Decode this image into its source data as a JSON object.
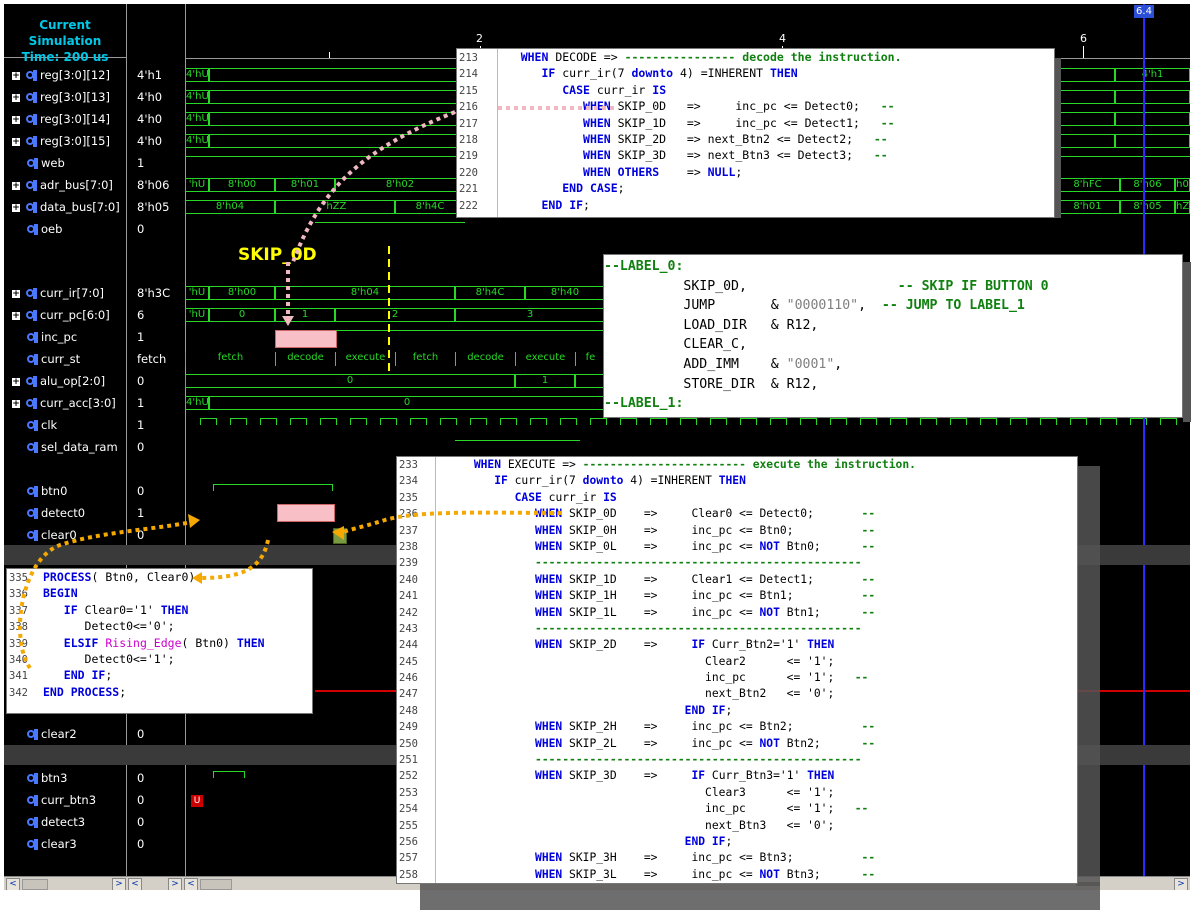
{
  "simulation": {
    "title_line1": "Current Simulation",
    "title_line2": "Time: 200 us",
    "cursor_label": "6.4",
    "ruler_labels": [
      "2",
      "4",
      "6"
    ]
  },
  "signals": [
    {
      "name": "reg[3:0][12]",
      "value": "4'h1",
      "expand": true,
      "icon": "bus-icon"
    },
    {
      "name": "reg[3:0][13]",
      "value": "4'h0",
      "expand": true,
      "icon": "bus-icon"
    },
    {
      "name": "reg[3:0][14]",
      "value": "4'h0",
      "expand": true,
      "icon": "bus-icon"
    },
    {
      "name": "reg[3:0][15]",
      "value": "4'h0",
      "expand": true,
      "icon": "bus-icon"
    },
    {
      "name": "web",
      "value": "1",
      "expand": false,
      "icon": "bit-icon"
    },
    {
      "name": "adr_bus[7:0]",
      "value": "8'h06",
      "expand": true,
      "icon": "bus-icon"
    },
    {
      "name": "data_bus[7:0]",
      "value": "8'h05",
      "expand": true,
      "icon": "bus-icon"
    },
    {
      "name": "oeb",
      "value": "0",
      "expand": false,
      "icon": "bit-icon"
    },
    {
      "name": "curr_ir[7:0]",
      "value": "8'h3C",
      "expand": true,
      "icon": "bus-icon"
    },
    {
      "name": "curr_pc[6:0]",
      "value": "6",
      "expand": true,
      "icon": "bus-icon"
    },
    {
      "name": "inc_pc",
      "value": "1",
      "expand": false,
      "icon": "bit-icon"
    },
    {
      "name": "curr_st",
      "value": "fetch",
      "expand": false,
      "icon": "bit-icon"
    },
    {
      "name": "alu_op[2:0]",
      "value": "0",
      "expand": true,
      "icon": "bus-icon"
    },
    {
      "name": "curr_acc[3:0]",
      "value": "1",
      "expand": true,
      "icon": "bus-icon"
    },
    {
      "name": "clk",
      "value": "1",
      "expand": false,
      "icon": "bit-icon"
    },
    {
      "name": "sel_data_ram",
      "value": "0",
      "expand": false,
      "icon": "bit-icon"
    },
    {
      "name": "btn0",
      "value": "0",
      "expand": false,
      "icon": "bit-icon"
    },
    {
      "name": "detect0",
      "value": "1",
      "expand": false,
      "icon": "bit-icon"
    },
    {
      "name": "clear0",
      "value": "0",
      "expand": false,
      "icon": "bit-icon"
    },
    {
      "name": "clear2",
      "value": "0",
      "expand": false,
      "icon": "bit-icon"
    },
    {
      "name": "btn3",
      "value": "0",
      "expand": false,
      "icon": "bit-icon"
    },
    {
      "name": "curr_btn3",
      "value": "0",
      "expand": false,
      "icon": "bit-icon"
    },
    {
      "name": "detect3",
      "value": "0",
      "expand": false,
      "icon": "bit-icon"
    },
    {
      "name": "clear3",
      "value": "0",
      "expand": false,
      "icon": "bit-icon"
    }
  ],
  "waves": {
    "reg12_right": "4'h1",
    "adr_bus": [
      "'hU",
      "8'h00",
      "8'h01",
      "8'h02",
      "8'hFC",
      "8'h06",
      "h0"
    ],
    "data_bus": [
      "8'h04",
      "'hZZ",
      "8'h4C",
      "8'h01",
      "8'h05",
      "hZ"
    ],
    "curr_ir": [
      "'hU",
      "8'h00",
      "8'h04",
      "8'h4C",
      "8'h40"
    ],
    "curr_pc": [
      "'hU",
      "0",
      "1",
      "2",
      "3"
    ],
    "curr_st": [
      "fetch",
      "decode",
      "execute",
      "fetch",
      "decode",
      "execute",
      "fe"
    ],
    "alu_op": [
      "0",
      "1"
    ],
    "curr_acc": [
      "4'hU",
      "0"
    ],
    "undef_marker": "U",
    "reg_prefix": "4'hU"
  },
  "annotation": {
    "skip_label": "SKIP_0D"
  },
  "code_decode": [
    {
      "n": "213",
      "html": "    <span class=\"kw\">WHEN</span> DECODE => <span class=\"cm\">---------------- decode the instruction.</span>"
    },
    {
      "n": "214",
      "html": "       <span class=\"kw\">IF</span> curr_ir(7 <span class=\"kw\">downto</span> 4) =INHERENT <span class=\"kw\">THEN</span>"
    },
    {
      "n": "215",
      "html": "          <span class=\"kw\">CASE</span> curr_ir <span class=\"kw\">IS</span>"
    },
    {
      "n": "216",
      "html": "             <span class=\"kw\">WHEN</span> SKIP_0D   =>     inc_pc <= Detect0;   <span class=\"cm\">--</span>"
    },
    {
      "n": "217",
      "html": "             <span class=\"kw\">WHEN</span> SKIP_1D   =>     inc_pc <= Detect1;   <span class=\"cm\">--</span>"
    },
    {
      "n": "218",
      "html": "             <span class=\"kw\">WHEN</span> SKIP_2D   => next_Btn2 <= Detect2;   <span class=\"cm\">--</span>"
    },
    {
      "n": "219",
      "html": "             <span class=\"kw\">WHEN</span> SKIP_3D   => next_Btn3 <= Detect3;   <span class=\"cm\">--</span>"
    },
    {
      "n": "220",
      "html": "             <span class=\"kw\">WHEN</span> <span class=\"kw\">OTHERS</span>    => <span class=\"kw\">NULL</span>;"
    },
    {
      "n": "221",
      "html": "          <span class=\"kw\">END</span> <span class=\"kw\">CASE</span>;"
    },
    {
      "n": "222",
      "html": "       <span class=\"kw\">END</span> <span class=\"kw\">IF</span>;"
    }
  ],
  "code_asm": [
    "<span class=\"cm\">--LABEL_0:</span>",
    "          SKIP_0D,                   <span class=\"cm\">-- SKIP IF BUTTON 0</span>",
    "          JUMP       & <span class=\"st\">\"0000110\"</span>,  <span class=\"cm\">-- JUMP TO LABEL_1</span>",
    "          LOAD_DIR   & R12,",
    "          CLEAR_C,",
    "          ADD_IMM    & <span class=\"st\">\"0001\"</span>,",
    "          STORE_DIR  & R12,",
    "<span class=\"cm\">--LABEL_1:</span>"
  ],
  "code_execute": [
    {
      "n": "233",
      "html": "      <span class=\"kw\">WHEN</span> EXECUTE => <span class=\"cm\">------------------------ execute the instruction.</span>"
    },
    {
      "n": "234",
      "html": "         <span class=\"kw\">IF</span> curr_ir(7 <span class=\"kw\">downto</span> 4) =INHERENT <span class=\"kw\">THEN</span>"
    },
    {
      "n": "235",
      "html": "            <span class=\"kw\">CASE</span> curr_ir <span class=\"kw\">IS</span>"
    },
    {
      "n": "236",
      "html": "               <span class=\"kw\">WHEN</span> SKIP_0D    =>     Clear0 <= Detect0;       <span class=\"cm\">--</span>"
    },
    {
      "n": "237",
      "html": "               <span class=\"kw\">WHEN</span> SKIP_0H    =>     inc_pc <= Btn0;          <span class=\"cm\">--</span>"
    },
    {
      "n": "238",
      "html": "               <span class=\"kw\">WHEN</span> SKIP_0L    =>     inc_pc <= <span class=\"kw\">NOT</span> Btn0;      <span class=\"cm\">--</span>"
    },
    {
      "n": "239",
      "html": "               <span class=\"cm\">------------------------------------------------</span>"
    },
    {
      "n": "240",
      "html": "               <span class=\"kw\">WHEN</span> SKIP_1D    =>     Clear1 <= Detect1;       <span class=\"cm\">--</span>"
    },
    {
      "n": "241",
      "html": "               <span class=\"kw\">WHEN</span> SKIP_1H    =>     inc_pc <= Btn1;          <span class=\"cm\">--</span>"
    },
    {
      "n": "242",
      "html": "               <span class=\"kw\">WHEN</span> SKIP_1L    =>     inc_pc <= <span class=\"kw\">NOT</span> Btn1;      <span class=\"cm\">--</span>"
    },
    {
      "n": "243",
      "html": "               <span class=\"cm\">------------------------------------------------</span>"
    },
    {
      "n": "244",
      "html": "               <span class=\"kw\">WHEN</span> SKIP_2D    =>     <span class=\"kw\">IF</span> Curr_Btn2='1' <span class=\"kw\">THEN</span>"
    },
    {
      "n": "245",
      "html": "                                        Clear2      <= '1';"
    },
    {
      "n": "246",
      "html": "                                        inc_pc      <= '1';   <span class=\"cm\">--</span>"
    },
    {
      "n": "247",
      "html": "                                        next_Btn2   <= '0';"
    },
    {
      "n": "248",
      "html": "                                     <span class=\"kw\">END</span> <span class=\"kw\">IF</span>;"
    },
    {
      "n": "249",
      "html": "               <span class=\"kw\">WHEN</span> SKIP_2H    =>     inc_pc <= Btn2;          <span class=\"cm\">--</span>"
    },
    {
      "n": "250",
      "html": "               <span class=\"kw\">WHEN</span> SKIP_2L    =>     inc_pc <= <span class=\"kw\">NOT</span> Btn2;      <span class=\"cm\">--</span>"
    },
    {
      "n": "251",
      "html": "               <span class=\"cm\">------------------------------------------------</span>"
    },
    {
      "n": "252",
      "html": "               <span class=\"kw\">WHEN</span> SKIP_3D    =>     <span class=\"kw\">IF</span> Curr_Btn3='1' <span class=\"kw\">THEN</span>"
    },
    {
      "n": "253",
      "html": "                                        Clear3      <= '1';"
    },
    {
      "n": "254",
      "html": "                                        inc_pc      <= '1';   <span class=\"cm\">--</span>"
    },
    {
      "n": "255",
      "html": "                                        next_Btn3   <= '0';"
    },
    {
      "n": "256",
      "html": "                                     <span class=\"kw\">END</span> <span class=\"kw\">IF</span>;"
    },
    {
      "n": "257",
      "html": "               <span class=\"kw\">WHEN</span> SKIP_3H    =>     inc_pc <= Btn3;          <span class=\"cm\">--</span>"
    },
    {
      "n": "258",
      "html": "               <span class=\"kw\">WHEN</span> SKIP_3L    =>     inc_pc <= <span class=\"kw\">NOT</span> Btn3;      <span class=\"cm\">--</span>"
    }
  ],
  "code_process": [
    {
      "n": "335",
      "html": "<span class=\"kw\">PROCESS</span>( Btn0, Clear0)"
    },
    {
      "n": "336",
      "html": "<span class=\"kw\">BEGIN</span>"
    },
    {
      "n": "337",
      "html": "   <span class=\"kw\">IF</span> Clear0='1' <span class=\"kw\">THEN</span>"
    },
    {
      "n": "338",
      "html": "      Detect0<='0';"
    },
    {
      "n": "339",
      "html": "   <span class=\"kw\">ELSIF</span> <span class=\"fn\">Rising_Edge</span>( Btn0) <span class=\"kw\">THEN</span>"
    },
    {
      "n": "340",
      "html": "      Detect0<='1';"
    },
    {
      "n": "341",
      "html": "   <span class=\"kw\">END</span> <span class=\"kw\">IF</span>;"
    },
    {
      "n": "342",
      "html": "<span class=\"kw\">END</span> <span class=\"kw\">PROCESS</span>;"
    }
  ],
  "colors": {
    "wave_green": "#27d827",
    "title_cyan": "#00c8e8",
    "cursor_blue": "#2b2bff",
    "annotation_yellow": "#ffff00",
    "arrow_orange": "#f5a800",
    "highlight_pink": "#f8bfc6"
  }
}
